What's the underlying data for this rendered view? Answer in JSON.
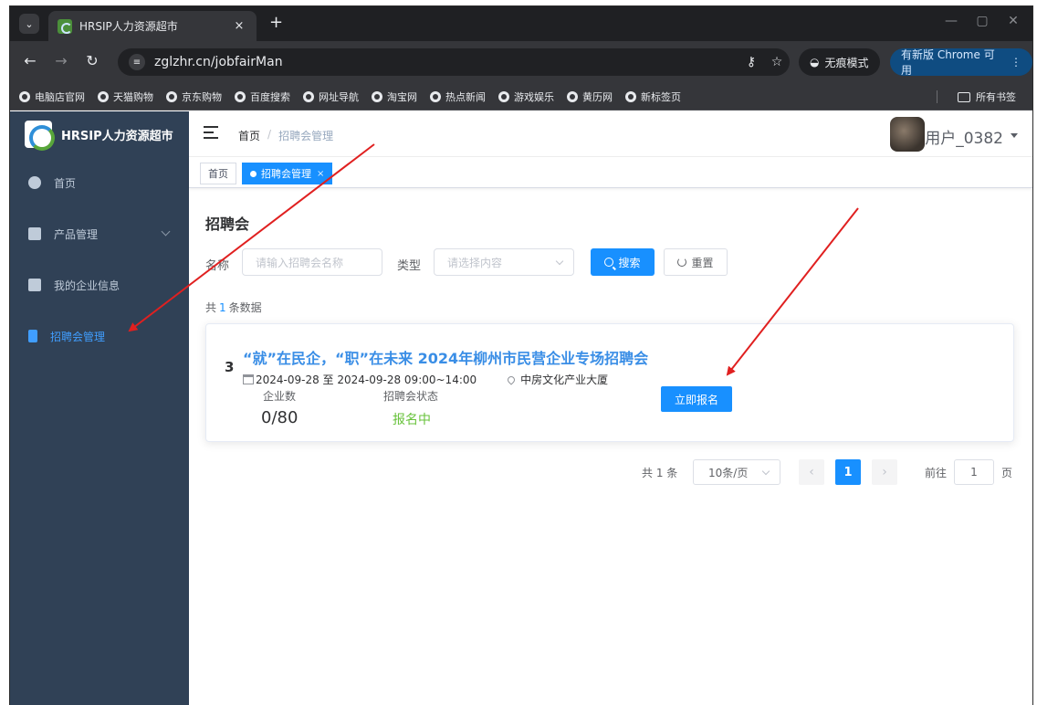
{
  "browser": {
    "tab_title": "HRSIP人力资源超市",
    "tab_close": "×",
    "new_tab": "+",
    "url": "zglzhr.cn/jobfairMan",
    "incognito": "无痕模式",
    "update": "有新版 Chrome 可用",
    "bookmarks": [
      "电脑店官网",
      "天猫购物",
      "京东购物",
      "百度搜索",
      "网址导航",
      "淘宝网",
      "热点新闻",
      "游戏娱乐",
      "黄历网",
      "新标签页"
    ],
    "all_bookmarks": "所有书签"
  },
  "sidebar": {
    "brand": "HRSIP人力资源超市",
    "items": [
      {
        "label": "首页"
      },
      {
        "label": "产品管理"
      },
      {
        "label": "我的企业信息"
      },
      {
        "label": "招聘会管理"
      }
    ]
  },
  "header": {
    "breadcrumb_home": "首页",
    "breadcrumb_sep": "/",
    "breadcrumb_current": "招聘会管理",
    "username": "用户_0382"
  },
  "tags": {
    "home": "首页",
    "current": "招聘会管理",
    "close": "×"
  },
  "page": {
    "title": "招聘会",
    "name_label": "名称",
    "name_placeholder": "请输入招聘会名称",
    "type_label": "类型",
    "type_placeholder": "请选择内容",
    "search_label": "搜索",
    "reset_label": "重置",
    "total_prefix": "共",
    "total_count": "1",
    "total_suffix": "条数据"
  },
  "fair": {
    "index": "3",
    "title": "“就”在民企，“职”在未来 2024年柳州市民营企业专场招聘会",
    "date": "2024-09-28 至 2024-09-28 09:00~14:00",
    "location": "中房文化产业大厦",
    "company_count_label": "企业数",
    "company_count": "0/80",
    "status_label": "招聘会状态",
    "status": "报名中",
    "signup_label": "立即报名"
  },
  "pagination": {
    "total": "共 1 条",
    "page_size": "10条/页",
    "prev": "‹",
    "current_page": "1",
    "next": "›",
    "goto_label": "前往",
    "goto_value": "1",
    "page_unit": "页"
  },
  "colors": {
    "sidebar_bg": "#304156",
    "primary": "#1890ff",
    "title_blue": "#3a8ee6",
    "status_green": "#67c23a",
    "arrow_red": "#e02020"
  }
}
